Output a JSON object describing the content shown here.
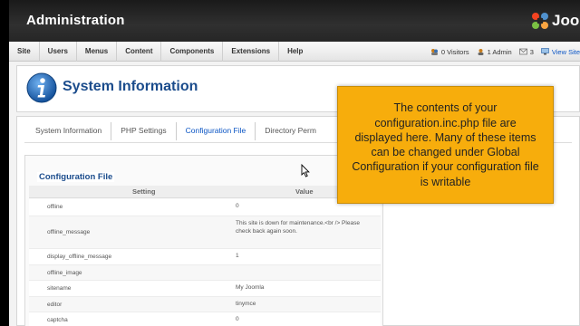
{
  "header": {
    "title": "Administration",
    "logo_text": "Joo"
  },
  "menu": [
    "Site",
    "Users",
    "Menus",
    "Content",
    "Components",
    "Extensions",
    "Help"
  ],
  "status": {
    "visitors": "0 Visitors",
    "admin": "1 Admin",
    "messages": "3",
    "view_site": "View Site"
  },
  "page": {
    "title": "System Information",
    "icon": "info-icon"
  },
  "tabs": [
    {
      "label": "System Information",
      "active": false
    },
    {
      "label": "PHP Settings",
      "active": false
    },
    {
      "label": "Configuration File",
      "active": true
    },
    {
      "label": "Directory Perm",
      "active": false
    }
  ],
  "config": {
    "legend": "Configuration File",
    "col_setting": "Setting",
    "col_value": "Value",
    "rows": [
      {
        "setting": "offline",
        "value": "0"
      },
      {
        "setting": "offline_message",
        "value": "This site is down for maintenance.<br /> Please check back again soon."
      },
      {
        "setting": "display_offline_message",
        "value": "1"
      },
      {
        "setting": "offline_image",
        "value": ""
      },
      {
        "setting": "sitename",
        "value": "My Joomla"
      },
      {
        "setting": "editor",
        "value": "tinymce"
      },
      {
        "setting": "captcha",
        "value": "0"
      }
    ]
  },
  "tooltip": {
    "text": "The contents of your configuration.inc.php file are displayed here. Many of these items can be changed under Global Configuration if your configuration file is writable"
  },
  "colors": {
    "accent": "#1b4c8c",
    "link": "#0b55c4",
    "tooltip_bg": "#f7ad0c",
    "header_bg": "#262626"
  }
}
